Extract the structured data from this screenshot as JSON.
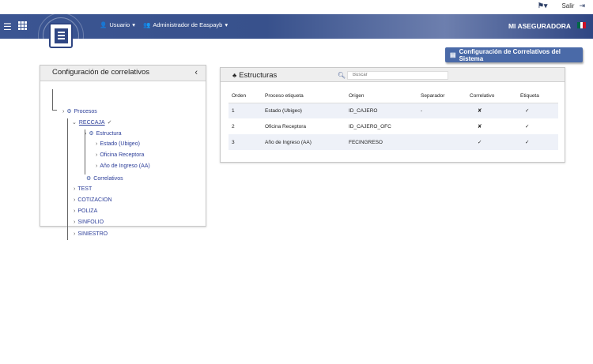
{
  "topbar": {
    "salir_label": "Salir",
    "help_icon": "help-flag-icon",
    "logout_icon": "logout-icon"
  },
  "navbar": {
    "user_label": "Usuario",
    "admin_label": "Administrador de Easpayb",
    "company": "MI ASEGURADORA",
    "flag_colors": [
      "#006847",
      "#ffffff",
      "#ce1126"
    ]
  },
  "system_button_label": "Configuración de Correlativos del Sistema",
  "left_panel": {
    "title": "Configuración de correlativos",
    "tree": {
      "procesos": "Procesos",
      "reccaja": "RECCAJA",
      "estructura": "Estructura",
      "estado": "Estado (Ubigeo)",
      "oficina": "Oficina Receptora",
      "anio": "Año de Ingreso (AA)",
      "correlativos": "Correlativos",
      "test": "TEST",
      "cotizacion": "COTIZACION",
      "poliza": "POLIZA",
      "sinfolio": "SINFOLIO",
      "siniestro": "SINIESTRO"
    }
  },
  "right_panel": {
    "title": "Estructuras",
    "search_placeholder": "Buscar",
    "columns": [
      "Orden",
      "Proceso etiqueta",
      "Origen",
      "Separador",
      "Correlativo",
      "Etiqueta"
    ],
    "rows": [
      [
        "1",
        "Estado (Ubigeo)",
        "ID_CAJERO",
        "-",
        "✘",
        "✓"
      ],
      [
        "2",
        "Oficina Receptora",
        "ID_CAJERO_OFC",
        "",
        "✘",
        "✓"
      ],
      [
        "3",
        "Año de Ingreso (AA)",
        "FECINGRESO",
        "",
        "✓",
        "✓"
      ]
    ]
  },
  "colors": {
    "navbar": "#3b5592",
    "accent_button": "#4a6aa8",
    "tree_link": "#2c3e99"
  }
}
